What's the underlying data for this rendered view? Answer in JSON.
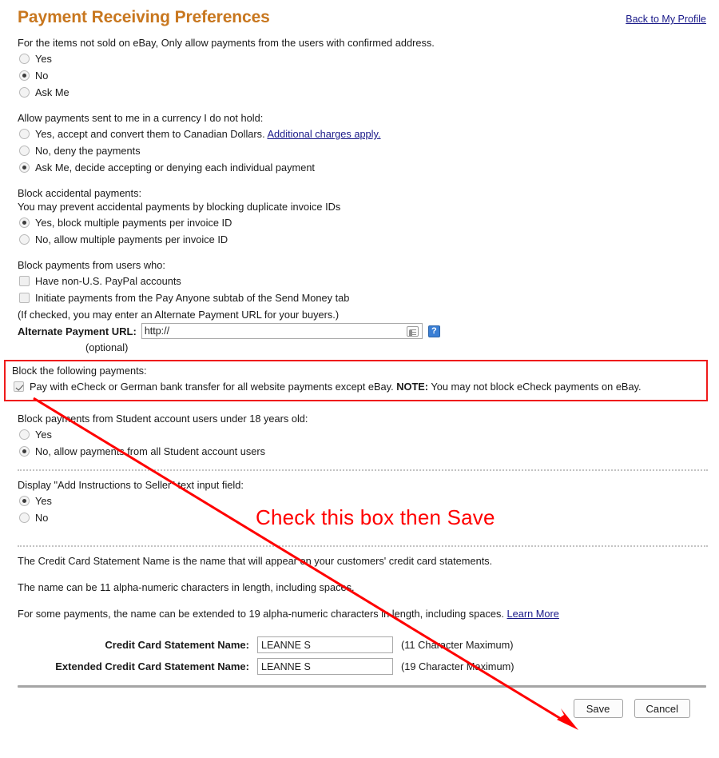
{
  "header": {
    "title": "Payment Receiving Preferences",
    "back_link": "Back to My Profile",
    "title_color": "#c8771f",
    "link_color": "#181888"
  },
  "sections": {
    "confirmed_address": {
      "prompt": "For the items not sold on eBay, Only allow payments from the users with confirmed address.",
      "options": [
        {
          "label": "Yes",
          "selected": false
        },
        {
          "label": "No",
          "selected": true
        },
        {
          "label": "Ask Me",
          "selected": false
        }
      ]
    },
    "currency": {
      "prompt": "Allow payments sent to me in a currency I do not hold:",
      "options": [
        {
          "label": "Yes, accept and convert them to Canadian Dollars.",
          "link": "Additional charges apply.",
          "selected": false
        },
        {
          "label": "No, deny the payments",
          "selected": false
        },
        {
          "label": "Ask Me, decide accepting or denying each individual payment",
          "selected": true
        }
      ]
    },
    "accidental": {
      "prompt": "Block accidental payments:",
      "subprompt": "You may prevent accidental payments by blocking duplicate invoice IDs",
      "options": [
        {
          "label": "Yes, block multiple payments per invoice ID",
          "selected": true
        },
        {
          "label": "No, allow multiple payments per invoice ID",
          "selected": false
        }
      ]
    },
    "block_users": {
      "prompt": "Block payments from users who:",
      "checkboxes": [
        {
          "label": "Have non-U.S. PayPal accounts",
          "checked": false
        },
        {
          "label": "Initiate payments from the Pay Anyone subtab of the Send Money tab",
          "checked": false
        }
      ],
      "url_note": "(If checked, you may enter an Alternate Payment URL for your buyers.)",
      "url_label": "Alternate Payment URL:",
      "url_value": "http://",
      "url_placeholder": "http://",
      "help_glyph": "?",
      "optional_note": "(optional)"
    },
    "block_following": {
      "prompt": "Block the following payments:",
      "checkbox": {
        "checked": true,
        "label_main": "Pay with eCheck or German bank transfer for all website payments except eBay.",
        "note_bold": "NOTE:",
        "note_rest": "You may not block eCheck payments on eBay."
      },
      "highlight_color": "#ef1b1b"
    },
    "student": {
      "prompt": "Block payments from Student account users under 18 years old:",
      "options": [
        {
          "label": "Yes",
          "selected": false
        },
        {
          "label": "No, allow payments from all Student account users",
          "selected": true
        }
      ]
    },
    "instructions": {
      "prompt": "Display \"Add Instructions to Seller\" text input field:",
      "options": [
        {
          "label": "Yes",
          "selected": true
        },
        {
          "label": "No",
          "selected": false
        }
      ]
    },
    "statement": {
      "paragraph_1": "The Credit Card Statement Name is the name that will appear on your customers' credit card statements.",
      "paragraph_2": "The name can be 11 alpha-numeric characters in length, including spaces.",
      "paragraph_3": "For some payments, the name can be extended to 19 alpha-numeric characters in length, including spaces.",
      "learn_more": "Learn More",
      "fields": [
        {
          "label": "Credit Card Statement Name:",
          "value": "LEANNE S",
          "hint": "(11 Character Maximum)"
        },
        {
          "label": "Extended Credit Card Statement Name:",
          "value": "LEANNE S",
          "hint": "(19 Character Maximum)"
        }
      ]
    }
  },
  "footer": {
    "save_label": "Save",
    "cancel_label": "Cancel"
  },
  "annotation": {
    "text": "Check this box then Save",
    "color": "#ff0000"
  }
}
